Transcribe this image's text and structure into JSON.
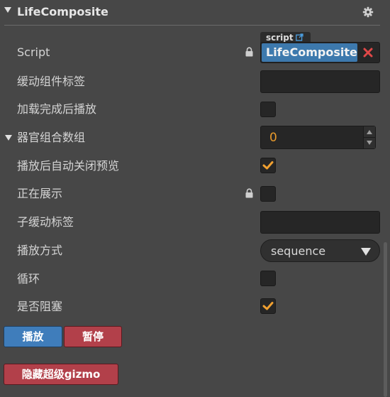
{
  "component": {
    "title": "LifeComposite",
    "settings_icon": "gear-icon"
  },
  "script": {
    "label": "Script",
    "tag": "script",
    "value": "LifeComposite",
    "lock_icon": "lock-icon",
    "clear_icon": "close-icon",
    "link_icon": "external-link-icon"
  },
  "fields": {
    "anim_tag_label": "缓动组件标签",
    "anim_tag_value": "",
    "play_after_load_label": "加载完成后播放",
    "play_after_load_checked": false,
    "organ_group_label": "器官组合数组",
    "organ_group_value": "0",
    "auto_close_preview_label": "播放后自动关闭预览",
    "auto_close_preview_checked": true,
    "showing_label": "正在展示",
    "showing_checked": false,
    "sub_anim_tag_label": "子缓动标签",
    "sub_anim_tag_value": "",
    "play_mode_label": "播放方式",
    "play_mode_value": "sequence",
    "loop_label": "循环",
    "loop_checked": false,
    "blocking_label": "是否阻塞",
    "blocking_checked": true
  },
  "buttons": {
    "play": "播放",
    "pause": "暂停",
    "hide_gizmo": "隐藏超级gizmo"
  },
  "colors": {
    "accent_blue": "#3f7dbb",
    "danger_red": "#b2404a",
    "check_orange": "#f0a030",
    "number_orange": "#e89a2c"
  }
}
